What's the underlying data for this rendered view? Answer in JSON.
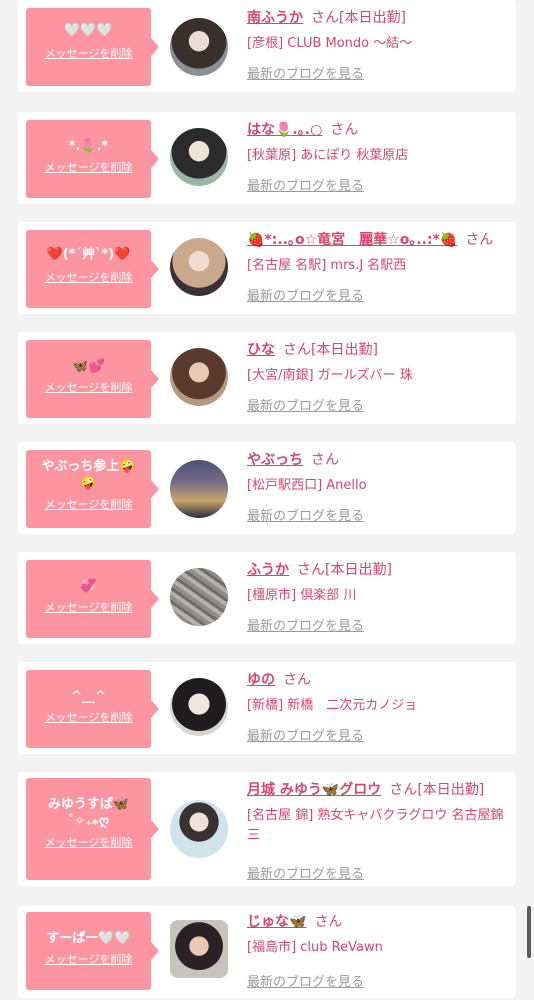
{
  "common": {
    "delete_label": "メッセージを削除",
    "blog_label": "最新のブログを見る",
    "san": "さん"
  },
  "colors": {
    "bubble": "#fd95a1",
    "accent": "#d6466b",
    "muted": "#9a9a9a"
  },
  "cards": [
    {
      "message": "🤍🤍🤍",
      "name": "南ふうか",
      "badge": "[本日出勤]",
      "shop": "[彦根] CLUB Mondo ～結～"
    },
    {
      "message": "*.🌷.*",
      "name": "はな🌷.｡.○",
      "badge": "",
      "shop": "[秋葉原] あにぽり 秋葉原店"
    },
    {
      "message": "❤️(*´艸`*)❤️",
      "name": "🍓*:..｡o☆竜宮　麗華☆o｡..:*🍓",
      "badge": "",
      "shop": "[名古屋 名駅] mrs.J 名駅西"
    },
    {
      "message": "🦋💕",
      "name": "ひな",
      "badge": "[本日出勤]",
      "shop": "[大宮/南銀] ガールズバー 珠"
    },
    {
      "message": "やぶっち参上🤪\n🤪",
      "name": "やぶっち",
      "badge": "",
      "shop": "[松戸駅西口] Anello"
    },
    {
      "message": "💞",
      "name": "ふうか",
      "badge": "[本日出勤]",
      "shop": "[橿原市] 倶楽部 川"
    },
    {
      "message": "^__^",
      "name": "ゆの",
      "badge": "",
      "shop": "[新橋] 新橋　二次元カノジョ"
    },
    {
      "message": "みゆうすぱ🦋\n˚✧₊⁎ღ",
      "name": "月城 みゆう🦋グロウ",
      "badge": "[本日出勤]",
      "shop": "[名古屋 錦] 熟女キャバクラグロウ 名古屋錦三"
    },
    {
      "message": "すーぱー🤍🤍",
      "name": "じゅな🦋",
      "badge": "",
      "shop": "[福島市] club ReVawn"
    }
  ]
}
